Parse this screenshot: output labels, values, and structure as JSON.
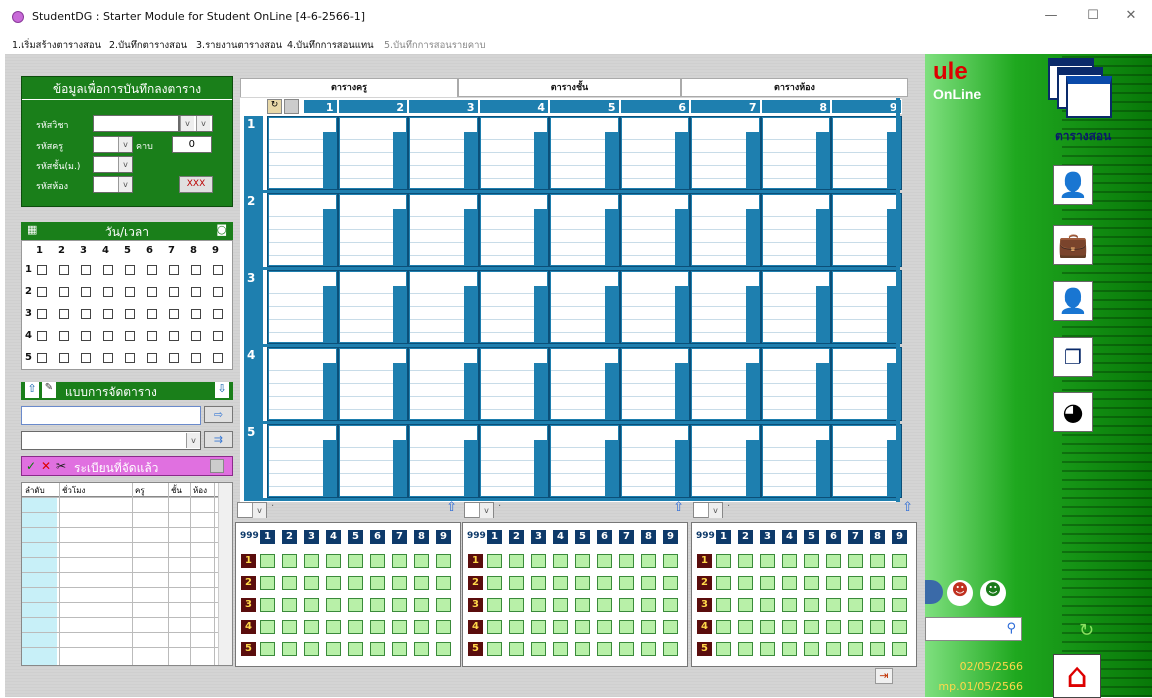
{
  "window": {
    "title": "StudentDG : Starter Module for Student OnLine [4-6-2566-1]",
    "minimize": "—",
    "maximize": "☐",
    "close": "✕"
  },
  "menu": [
    "1.เริ่มสร้างตารางสอน",
    "2.บันทึกตารางสอน",
    "3.รายงานตารางสอน",
    "4.บันทึกการสอนแทน",
    "5.บันทึกการสอนรายคาบ"
  ],
  "form": {
    "title": "ข้อมูลเพื่อการบันทึกลงตาราง",
    "subject_label": "รหัสวิชา",
    "teacher_label": "รหัสครู",
    "period_label": "คาบ",
    "period_value": "0",
    "class_label": "รหัสชั้น(ม.)",
    "room_label": "รหัสห้อง",
    "clear_button": "XXX"
  },
  "datetime": {
    "title": "วัน/เวลา",
    "cols": [
      "1",
      "2",
      "3",
      "4",
      "5",
      "6",
      "7",
      "8",
      "9"
    ],
    "rows": [
      "1",
      "2",
      "3",
      "4",
      "5"
    ]
  },
  "pattern": {
    "title": "แบบการจัดตาราง"
  },
  "registered": {
    "title": "ระเบียนที่จัดแล้ว",
    "columns": [
      "ลำดับ",
      "ชั่วโมง",
      "ครู",
      "ชั้น",
      "ห้อง"
    ]
  },
  "tabs": [
    "ตารางครู",
    "ตารางชั้น",
    "ตารางห้อง"
  ],
  "grid": {
    "cols": [
      "1",
      "2",
      "3",
      "4",
      "5",
      "6",
      "7",
      "8",
      "9"
    ],
    "rows": [
      "1",
      "2",
      "3",
      "4",
      "5"
    ]
  },
  "bottom": {
    "head": "999",
    "cols": [
      "1",
      "2",
      "3",
      "4",
      "5",
      "6",
      "7",
      "8",
      "9"
    ],
    "rows": [
      "1",
      "2",
      "3",
      "4",
      "5"
    ],
    "dot": "·"
  },
  "right": {
    "logo_fragment": "ule",
    "logo_sub": "OnLine",
    "app_label": "ตารางสอน",
    "date1": "02/05/2566",
    "date2": "mp.01/05/2566"
  },
  "icons": {
    "up": "⇧",
    "down": "⇩",
    "arrow_right": "⇨",
    "double_arrow": "⇉",
    "check": "✓",
    "cross": "✕",
    "scissors": "✂",
    "save": "💾",
    "search": "🔍",
    "refresh": "↻",
    "home": "⌂",
    "exit": "⇥"
  }
}
